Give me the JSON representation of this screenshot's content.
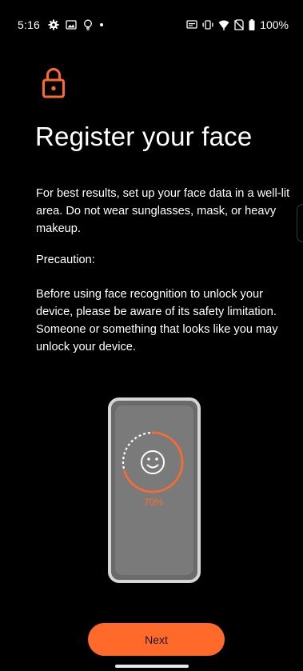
{
  "status_bar": {
    "time": "5:16",
    "battery_percent": "100%",
    "left_icons": [
      "gear-icon",
      "image-icon",
      "bulb-icon",
      "dot-icon"
    ],
    "right_icons": [
      "screencast-icon",
      "vibrate-icon",
      "wifi-icon",
      "no-sim-icon",
      "battery-icon"
    ]
  },
  "header": {
    "icon": "lock-icon",
    "title": "Register your face"
  },
  "content": {
    "paragraph1": "For best results, set up your face data in a well-lit area. Do not wear sunglasses, mask, or heavy makeup.",
    "paragraph2": "Precaution:",
    "paragraph3": "Before using face recognition to unlock your device, please be aware of its safety limitation. Someone or something that looks like you may unlock your device."
  },
  "illustration": {
    "progress_value": 0.7,
    "progress_label": "70%",
    "icon": "smiley-icon"
  },
  "actions": {
    "next_label": "Next"
  },
  "colors": {
    "accent": "#ff6a2b",
    "background": "#000000",
    "phone_frame": "#d6d6d6",
    "phone_screen": "#7a7a7a"
  }
}
